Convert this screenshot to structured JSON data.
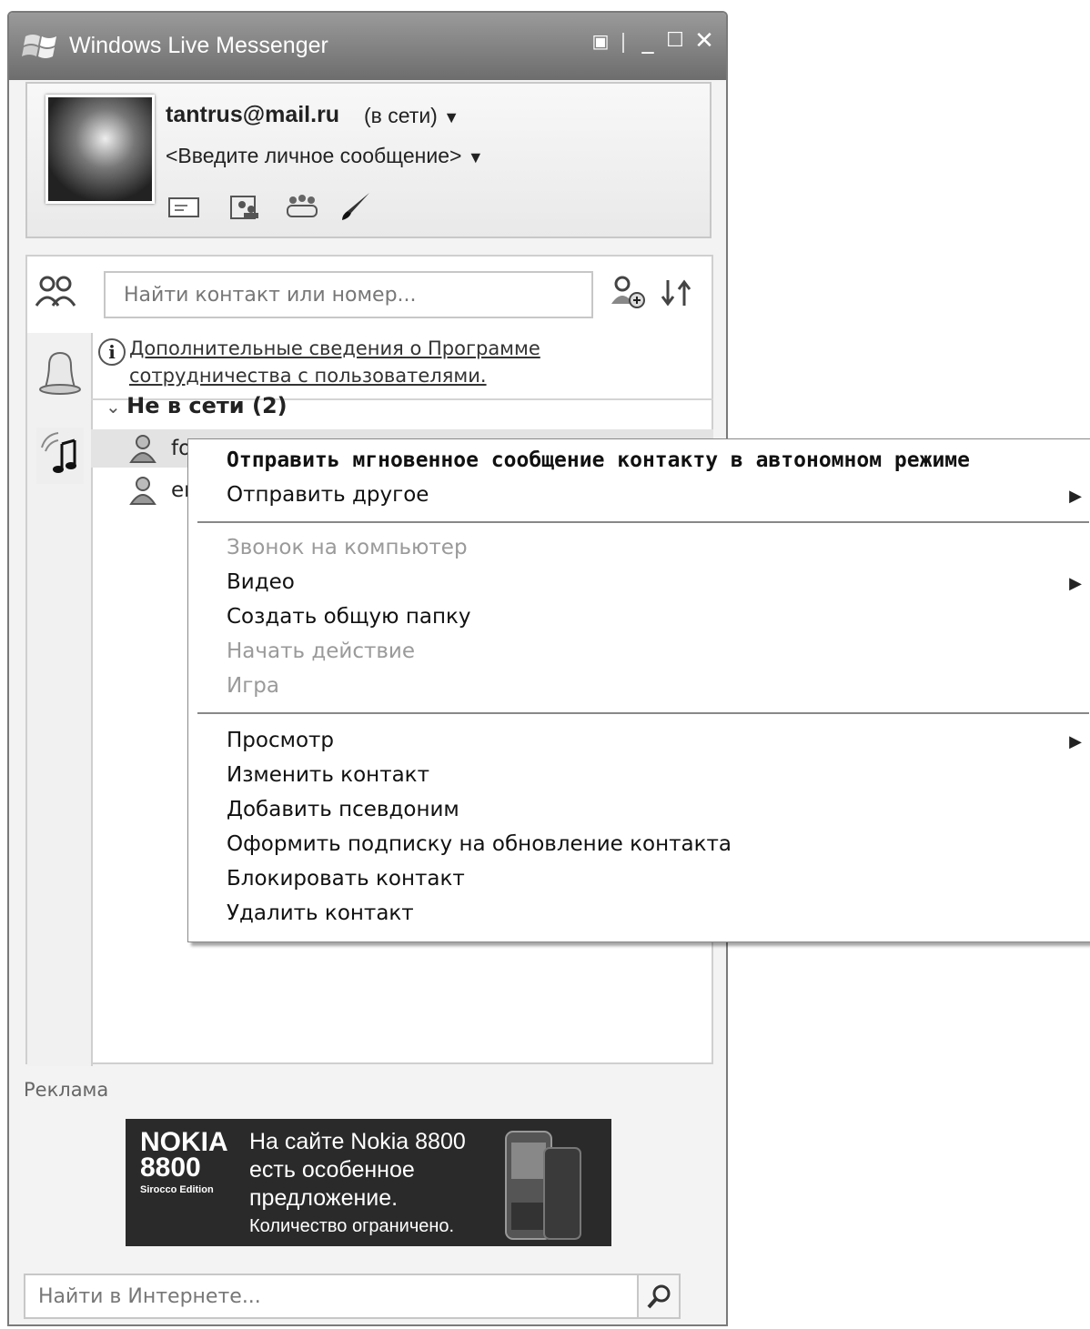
{
  "window": {
    "title": "Windows Live Messenger"
  },
  "profile": {
    "username": "tantrus@mail.ru",
    "status": "(в сети)",
    "personal_message": "<Введите личное сообщение>"
  },
  "contacts": {
    "search_placeholder": "Найти контакт или номер...",
    "info_link_line1": "Дополнительные сведения о Программе",
    "info_link_line2": "сотрудничества с пользователями.",
    "group_label": "Не в сети",
    "group_count": "(2)",
    "items": [
      {
        "label": "fo"
      },
      {
        "label": "er"
      }
    ]
  },
  "context_menu": {
    "items": [
      {
        "label": "Отправить мгновенное сообщение контакту в автономном режиме",
        "bold": true
      },
      {
        "label": "Отправить другое",
        "submenu": true
      },
      {
        "label": "Звонок на компьютер",
        "disabled": true
      },
      {
        "label": "Видео",
        "submenu": true
      },
      {
        "label": "Создать общую папку"
      },
      {
        "label": "Начать действие",
        "disabled": true
      },
      {
        "label": "Игра",
        "disabled": true
      },
      {
        "label": "Просмотр",
        "submenu": true
      },
      {
        "label": "Изменить контакт"
      },
      {
        "label": "Добавить псевдоним"
      },
      {
        "label": "Оформить подписку на обновление контакта"
      },
      {
        "label": "Блокировать контакт"
      },
      {
        "label": "Удалить контакт"
      }
    ]
  },
  "ad": {
    "label": "Реклама",
    "brand_line1": "NOKIA",
    "brand_line2": "8800",
    "brand_line3": "Sirocco Edition",
    "line1": "На сайте Nokia 8800",
    "line2": "есть особенное",
    "line3": "предложение.",
    "line4": "Количество ограничено."
  },
  "web_search": {
    "placeholder": "Найти в Интернете..."
  },
  "icons": [
    "windows-logo-icon",
    "menu-icon",
    "minimize-icon",
    "maximize-icon",
    "close-icon",
    "email-icon",
    "contacts-icon",
    "groups-icon",
    "paint-icon",
    "contacts-tab-icon",
    "add-contact-icon",
    "sort-icon",
    "bell-icon",
    "music-icon",
    "info-icon",
    "contact-person-icon",
    "search-icon",
    "submenu-arrow-icon"
  ]
}
